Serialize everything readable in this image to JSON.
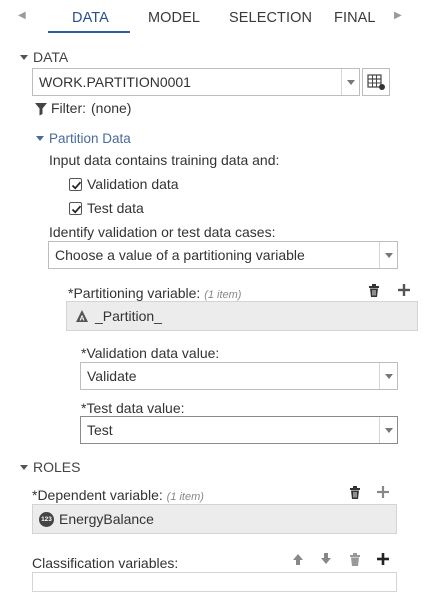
{
  "tabs": [
    {
      "label": "DATA",
      "active": true
    },
    {
      "label": "MODEL",
      "active": false
    },
    {
      "label": "SELECTION",
      "active": false
    },
    {
      "label": "FINAL I",
      "active": false
    }
  ],
  "data_section": {
    "title": "DATA",
    "dataset_value": "WORK.PARTITION0001",
    "filter_label": "Filter:",
    "filter_value": "(none)"
  },
  "partition": {
    "title": "Partition Data",
    "intro_text": "Input data contains training data and:",
    "validation_checkbox_label": "Validation data",
    "validation_checked": true,
    "test_checkbox_label": "Test data",
    "test_checked": true,
    "identify_label": "Identify validation or test data cases:",
    "identify_value": "Choose a value of a partitioning variable",
    "partition_var_label": "*Partitioning variable:",
    "partition_var_hint": "(1 item)",
    "partition_var_value": "_Partition_",
    "validation_value_label": "*Validation data value:",
    "validation_value": "Validate",
    "test_value_label": "*Test data value:",
    "test_value": "Test"
  },
  "roles": {
    "title": "ROLES",
    "dependent_label": "*Dependent variable:",
    "dependent_hint": "(1 item)",
    "dependent_value": "EnergyBalance",
    "numeric_badge": "123",
    "classification_label": "Classification variables:"
  },
  "colors": {
    "accent": "#2a5fa0",
    "text": "#333333",
    "role_box_bg": "#ececec"
  }
}
